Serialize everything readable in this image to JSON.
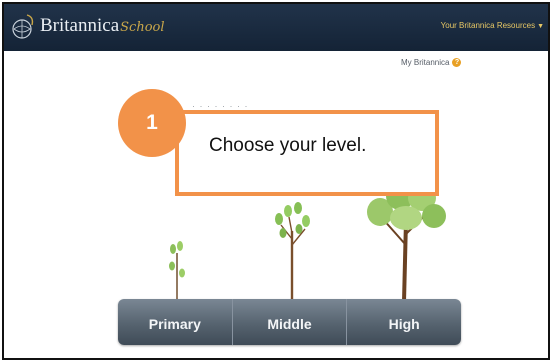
{
  "header": {
    "brand_name": "Britannica",
    "brand_sub": "School",
    "resources_label": "Your Britannica Resources"
  },
  "account": {
    "my_britannica_label": "My Britannica",
    "help_badge": "?"
  },
  "tutorial": {
    "step_number": "1",
    "instruction": "Choose your level."
  },
  "levels": [
    {
      "label": "Primary"
    },
    {
      "label": "Middle"
    },
    {
      "label": "High"
    }
  ],
  "colors": {
    "topbar": "#1b2b40",
    "accent_orange": "#f29249",
    "resources_gold": "#e7c765",
    "level_bar": "#56636f"
  },
  "icons": {
    "brand": "globe-logo-icon",
    "help": "help-icon",
    "dropdown": "caret-down-icon"
  }
}
